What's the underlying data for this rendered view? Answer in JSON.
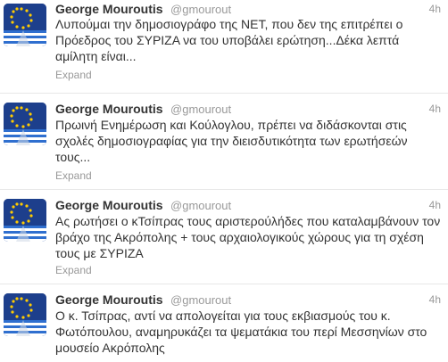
{
  "tweets": [
    {
      "fullname": "George Mouroutis",
      "username": "@gmourout",
      "time": "4h",
      "text": "Λυπούμαι την δημοσιογράφο της ΝΕΤ, που δεν της επιτρέπει ο Πρόεδρος του ΣΥΡΙΖΑ να του υποβάλει ερώτηση...Δέκα λεπτά αμίλητη είναι...",
      "expand_label": "Expand",
      "avatar_icon": "eu-greek-flag-avatar"
    },
    {
      "fullname": "George Mouroutis",
      "username": "@gmourout",
      "time": "4h",
      "text": "Πρωινή Ενημέρωση και Κούλογλου, πρέπει να διδάσκονται στις σχολές δημοσιογραφίας για την διεισδυτικότητα των ερωτήσεών τους...",
      "expand_label": "Expand",
      "avatar_icon": "eu-greek-flag-avatar"
    },
    {
      "fullname": "George Mouroutis",
      "username": "@gmourout",
      "time": "4h",
      "text": "Ας ρωτήσει ο κΤσίπρας τους αριστερούλήδες που καταλαμβάνουν τον βράχο της Ακρόπολης + τους αρχαιολογικούς χώρους για τη σχέση τους με ΣΥΡΙΖΑ",
      "expand_label": "Expand",
      "avatar_icon": "eu-greek-flag-avatar"
    },
    {
      "fullname": "George Mouroutis",
      "username": "@gmourout",
      "time": "4h",
      "text": "Ο κ. Τσίπρας, αντί να απολογείται για τους εκβιασμούς του κ. Φωτόπουλου, αναμηρυκάζει τα ψεματάκια του περί Μεσσηνίων στο μουσείο Ακρόπολης",
      "avatar_icon": "eu-greek-flag-avatar"
    }
  ],
  "colors": {
    "name": "#333333",
    "meta": "#999999",
    "separator": "#e8e8e8",
    "eu_blue": "#1d3f8c",
    "eu_star": "#ffcc00",
    "greek_blue": "#2f6fcf"
  }
}
